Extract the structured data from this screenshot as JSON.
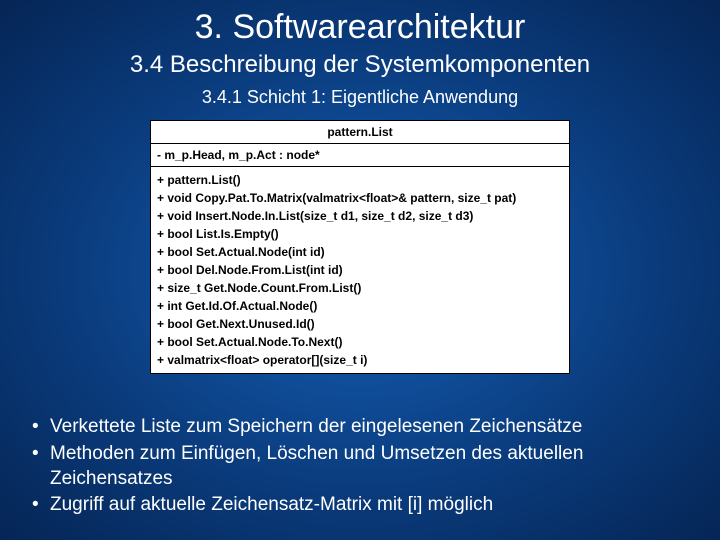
{
  "title": "3. Softwarearchitektur",
  "subtitle": "3.4 Beschreibung der Systemkomponenten",
  "subsubtitle": "3.4.1 Schicht 1: Eigentliche Anwendung",
  "uml": {
    "className": "pattern.List",
    "attributes": "- m_p.Head, m_p.Act : node*",
    "methods": [
      "+ pattern.List()",
      "+ void Copy.Pat.To.Matrix(valmatrix<float>& pattern, size_t pat)",
      "+ void Insert.Node.In.List(size_t d1, size_t d2, size_t d3)",
      "+ bool List.Is.Empty()",
      "+ bool Set.Actual.Node(int id)",
      "+ bool Del.Node.From.List(int id)",
      "+ size_t Get.Node.Count.From.List()",
      "+ int Get.Id.Of.Actual.Node()",
      "+ bool Get.Next.Unused.Id()",
      "+ bool Set.Actual.Node.To.Next()",
      "+ valmatrix<float> operator[](size_t i)"
    ]
  },
  "bullets": [
    "Verkettete Liste zum Speichern der eingelesenen Zeichensätze",
    "Methoden zum Einfügen, Löschen und Umsetzen des aktuellen Zeichensatzes",
    "Zugriff auf aktuelle Zeichensatz-Matrix mit [i] möglich"
  ]
}
